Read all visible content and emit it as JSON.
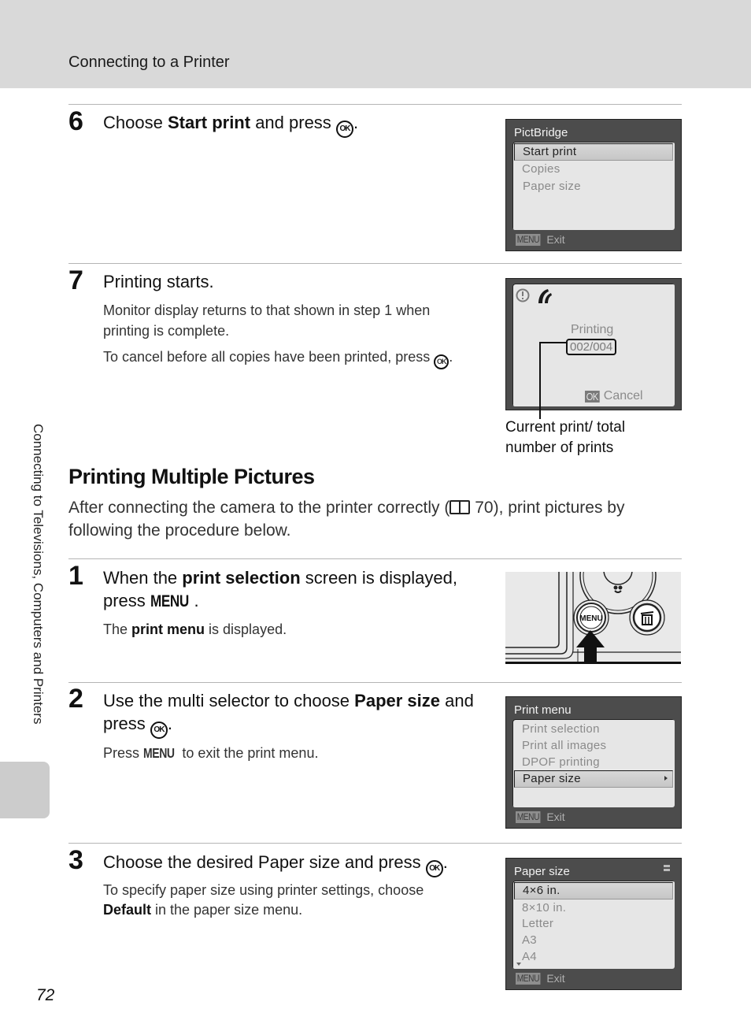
{
  "header": {
    "title": "Connecting to a Printer"
  },
  "sidebar": {
    "chapter_label": "Connecting to Televisions, Computers and Printers"
  },
  "page_number": "72",
  "step6": {
    "number": "6",
    "title_pre": "Choose ",
    "title_bold": "Start print",
    "title_post": " and press",
    "ok_icon": "ok-button-icon",
    "ok_label": "OK",
    "screen": {
      "title": "PictBridge",
      "items": [
        {
          "label": "Start print",
          "selected": true
        },
        {
          "label": "Copies",
          "selected": false
        },
        {
          "label": "Paper size",
          "selected": false
        }
      ],
      "footer_badge": "MENU",
      "footer_label": "Exit"
    }
  },
  "step7": {
    "number": "7",
    "title": "Printing starts.",
    "body1": "Monitor display returns to that shown in step 1 when printing is complete.",
    "body2": "To cancel before all copies have been printed, press",
    "ok_label": "OK",
    "screen": {
      "warning_icon": "warning-icon",
      "pictbridge_icon": "pictbridge-icon",
      "status": "Printing",
      "counter": "002/004",
      "footer_badge": "OK",
      "footer_label": "Cancel"
    },
    "caption_line1": "Current print/ total",
    "caption_line2": "number of prints"
  },
  "section": {
    "title": "Printing Multiple Pictures",
    "intro_pre": "After connecting the camera to the printer correctly (",
    "intro_ref": " 70), print pictures by following the procedure below."
  },
  "step1": {
    "number": "1",
    "title_pre": "When the ",
    "title_bold": "print selection",
    "title_post": " screen is displayed, press",
    "menu_label": "MENU",
    "body_pre": "The ",
    "body_bold": "print menu",
    "body_post": " is displayed.",
    "illustration": {
      "menu_button_label": "MENU",
      "delete_icon": "trash-icon",
      "macro_icon": "macro-flower-icon"
    }
  },
  "step2": {
    "number": "2",
    "title_pre": "Use the multi selector to choose ",
    "title_bold": "Paper size",
    "title_post": " and press",
    "ok_label": "OK",
    "body_pre": "Press ",
    "menu_label": "MENU",
    "body_post": " to exit the print menu.",
    "screen": {
      "title": "Print menu",
      "items": [
        {
          "label": "Print selection",
          "selected": false
        },
        {
          "label": "Print all images",
          "selected": false
        },
        {
          "label": "DPOF printing",
          "selected": false
        },
        {
          "label": "Paper size",
          "selected": true
        }
      ],
      "footer_badge": "MENU",
      "footer_label": "Exit"
    }
  },
  "step3": {
    "number": "3",
    "title": "Choose the desired Paper size and press",
    "ok_label": "OK",
    "body_pre": "To specify paper size using printer settings, choose ",
    "body_bold": "Default",
    "body_post": " in the paper size menu.",
    "screen": {
      "title": "Paper size",
      "items": [
        {
          "label": "4×6 in.",
          "selected": true
        },
        {
          "label": "8×10 in.",
          "selected": false
        },
        {
          "label": "Letter",
          "selected": false
        },
        {
          "label": "A3",
          "selected": false
        },
        {
          "label": "A4",
          "selected": false
        }
      ],
      "footer_badge": "MENU",
      "footer_label": "Exit"
    }
  }
}
